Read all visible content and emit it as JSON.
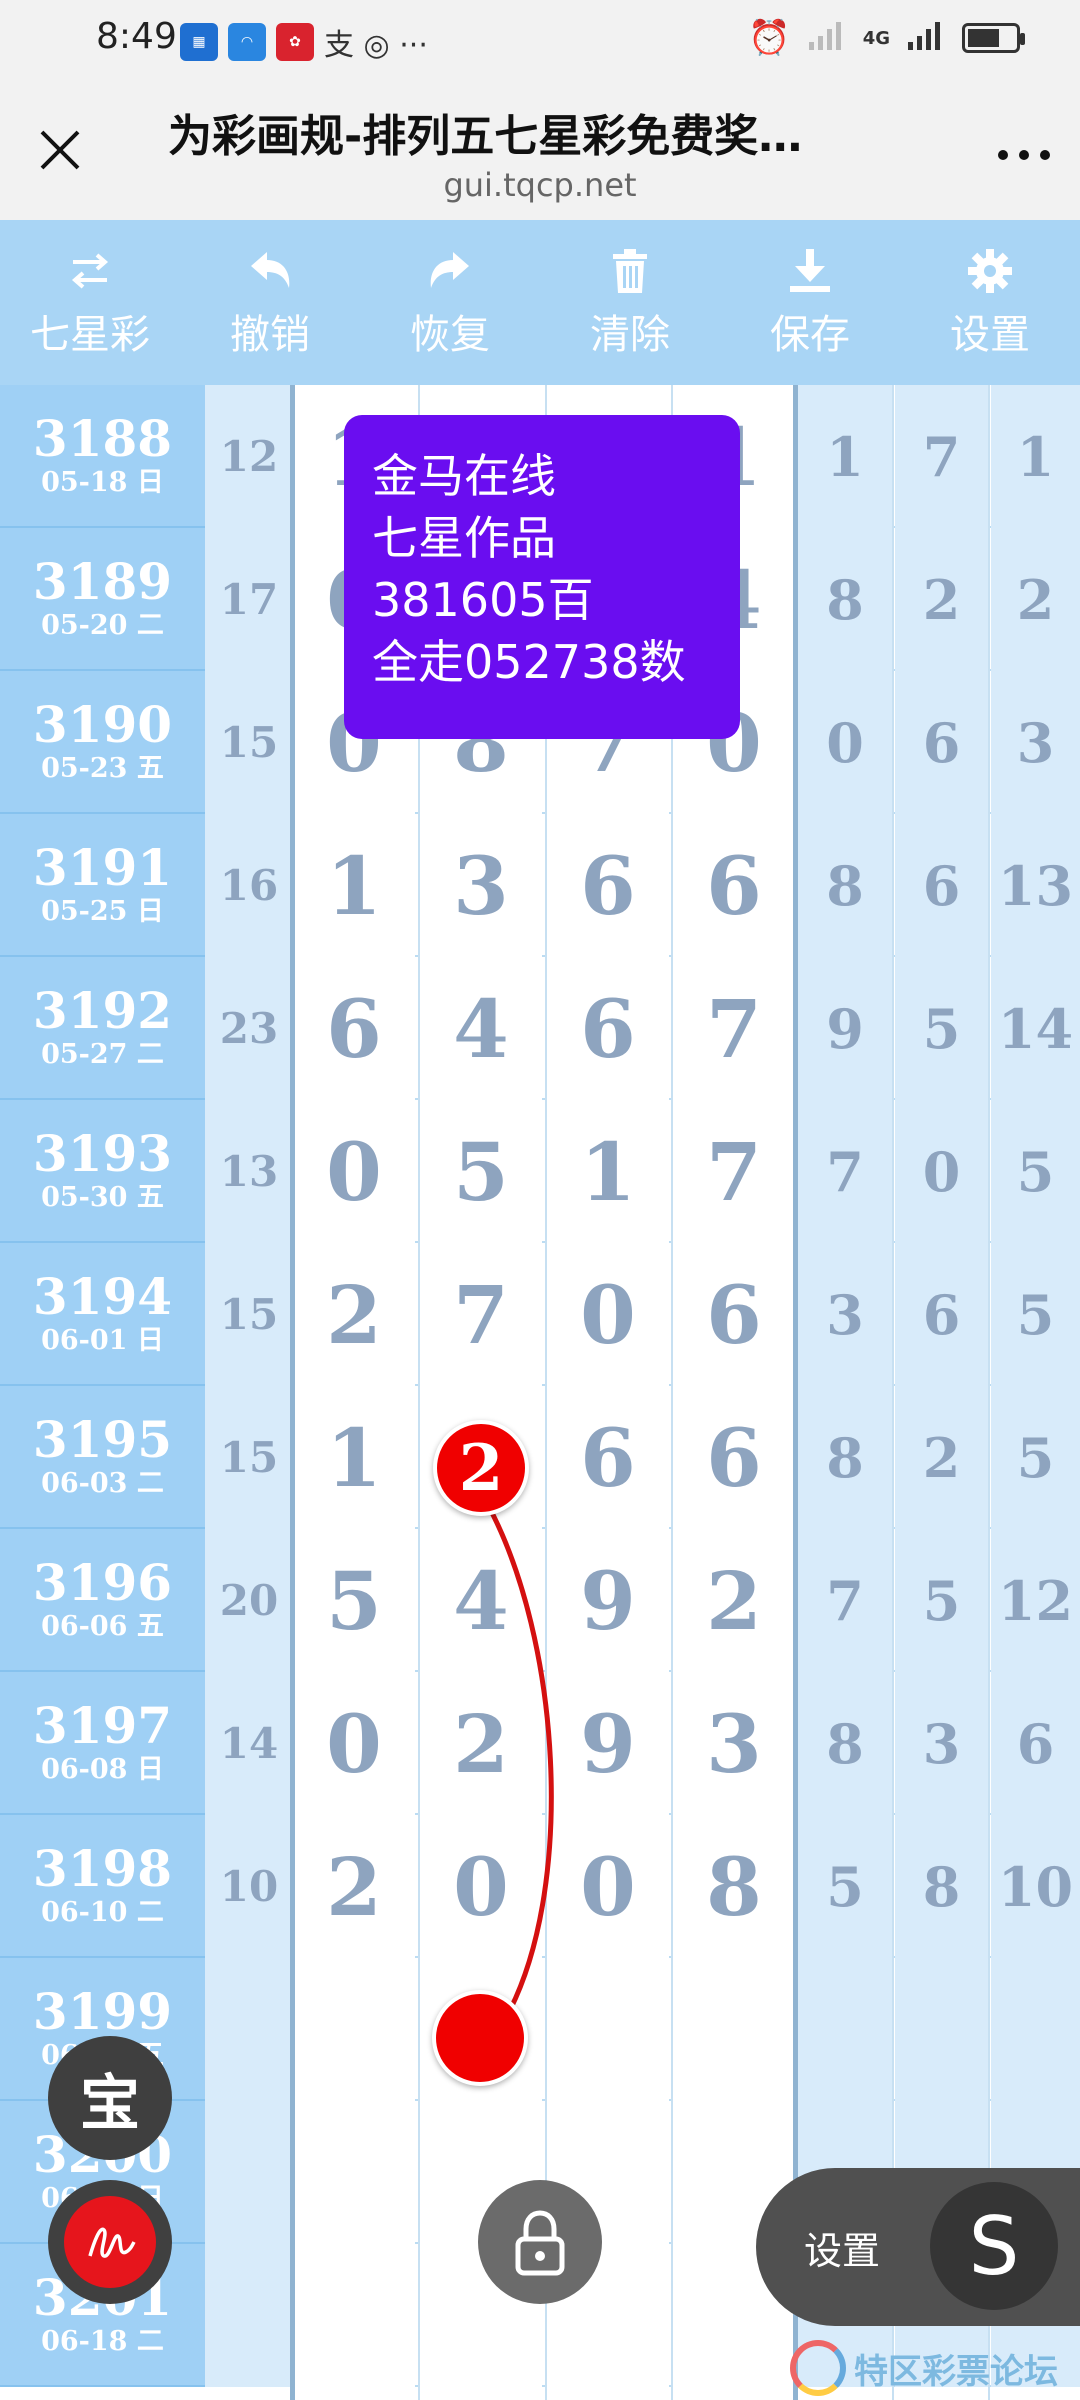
{
  "status_bar": {
    "time": "8:49",
    "extra_icons": "支 ◎ ···",
    "network": "4G"
  },
  "browser": {
    "title": "为彩画规-排列五七星彩免费奖…",
    "url": "gui.tqcp.net",
    "close_icon": "close-icon",
    "more_label": "⋮"
  },
  "toolbar": [
    {
      "name": "七星彩",
      "icon": "swap-icon"
    },
    {
      "name": "撤销",
      "icon": "undo-icon"
    },
    {
      "name": "恢复",
      "icon": "redo-icon"
    },
    {
      "name": "清除",
      "icon": "trash-icon"
    },
    {
      "name": "保存",
      "icon": "download-icon"
    },
    {
      "name": "设置",
      "icon": "gear-icon"
    }
  ],
  "rows": [
    {
      "issue": "3188",
      "date": "05-18 日",
      "sum": "12",
      "d": [
        "1",
        "",
        "",
        "1"
      ],
      "e": [
        "1",
        "7",
        "1"
      ]
    },
    {
      "issue": "3189",
      "date": "05-20 二",
      "sum": "17",
      "d": [
        "0",
        "",
        "",
        "4"
      ],
      "e": [
        "8",
        "2",
        "2"
      ]
    },
    {
      "issue": "3190",
      "date": "05-23 五",
      "sum": "15",
      "d": [
        "0",
        "8",
        "7",
        "0"
      ],
      "e": [
        "0",
        "6",
        "3"
      ]
    },
    {
      "issue": "3191",
      "date": "05-25 日",
      "sum": "16",
      "d": [
        "1",
        "3",
        "6",
        "6"
      ],
      "e": [
        "8",
        "6",
        "13"
      ]
    },
    {
      "issue": "3192",
      "date": "05-27 二",
      "sum": "23",
      "d": [
        "6",
        "4",
        "6",
        "7"
      ],
      "e": [
        "9",
        "5",
        "14"
      ]
    },
    {
      "issue": "3193",
      "date": "05-30 五",
      "sum": "13",
      "d": [
        "0",
        "5",
        "1",
        "7"
      ],
      "e": [
        "7",
        "0",
        "5"
      ]
    },
    {
      "issue": "3194",
      "date": "06-01 日",
      "sum": "15",
      "d": [
        "2",
        "7",
        "0",
        "6"
      ],
      "e": [
        "3",
        "6",
        "5"
      ]
    },
    {
      "issue": "3195",
      "date": "06-03 二",
      "sum": "15",
      "d": [
        "1",
        "",
        "6",
        "6"
      ],
      "e": [
        "8",
        "2",
        "5"
      ]
    },
    {
      "issue": "3196",
      "date": "06-06 五",
      "sum": "20",
      "d": [
        "5",
        "4",
        "9",
        "2"
      ],
      "e": [
        "7",
        "5",
        "12"
      ]
    },
    {
      "issue": "3197",
      "date": "06-08 日",
      "sum": "14",
      "d": [
        "0",
        "2",
        "9",
        "3"
      ],
      "e": [
        "8",
        "3",
        "6"
      ]
    },
    {
      "issue": "3198",
      "date": "06-10 二",
      "sum": "10",
      "d": [
        "2",
        "0",
        "0",
        "8"
      ],
      "e": [
        "5",
        "8",
        "10"
      ]
    },
    {
      "issue": "3199",
      "date": "06-13 五",
      "sum": "",
      "d": [
        "",
        "",
        "",
        ""
      ],
      "e": [
        "",
        "",
        ""
      ]
    },
    {
      "issue": "3200",
      "date": "06-15 日",
      "sum": "",
      "d": [
        "",
        "",
        "",
        ""
      ],
      "e": [
        "",
        "",
        ""
      ]
    },
    {
      "issue": "3201",
      "date": "06-18 二",
      "sum": "",
      "d": [
        "",
        "",
        "",
        ""
      ],
      "e": [
        "",
        "",
        ""
      ]
    }
  ],
  "info_box": {
    "lines": [
      "金马在线",
      "七星作品",
      "381605百",
      "全走052738数"
    ],
    "color": "#6a0df0"
  },
  "marked_circle": {
    "value": "2",
    "color": "#f00000"
  },
  "floating": {
    "bao_label": "宝",
    "settings_label": "设置",
    "settings_s": "S"
  },
  "watermark": "特区彩票论坛",
  "colors": {
    "toolbar_bg": "#a9d5f5",
    "issue_bg": "#9fd0f5",
    "digit_color": "#8ea4bf"
  }
}
